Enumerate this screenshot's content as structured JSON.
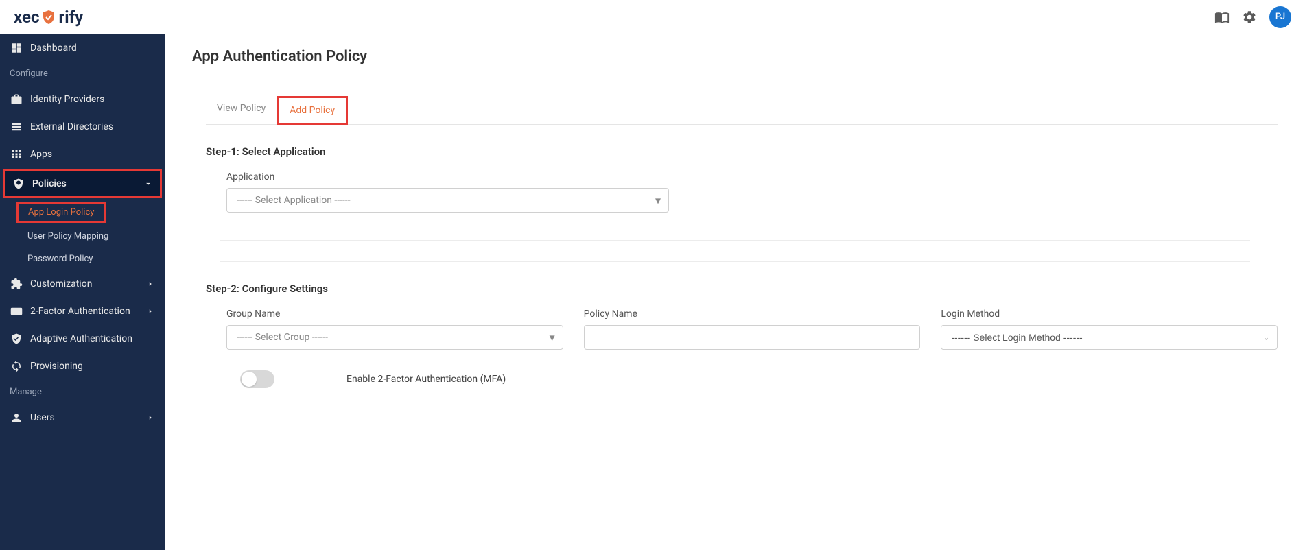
{
  "header": {
    "logo_text_1": "xec",
    "logo_text_2": "rify",
    "avatar": "PJ"
  },
  "sidebar": {
    "items": {
      "dashboard": "Dashboard",
      "configure_section": "Configure",
      "identity_providers": "Identity Providers",
      "external_directories": "External Directories",
      "apps": "Apps",
      "policies": "Policies",
      "app_login_policy": "App Login Policy",
      "user_policy_mapping": "User Policy Mapping",
      "password_policy": "Password Policy",
      "customization": "Customization",
      "two_factor_auth": "2-Factor Authentication",
      "adaptive_auth": "Adaptive Authentication",
      "provisioning": "Provisioning",
      "manage_section": "Manage",
      "users": "Users"
    }
  },
  "page": {
    "title": "App Authentication Policy",
    "tabs": {
      "view": "View Policy",
      "add": "Add Policy"
    },
    "step1": {
      "title": "Step-1: Select Application",
      "application_label": "Application",
      "application_placeholder": "------ Select Application ------"
    },
    "step2": {
      "title": "Step-2: Configure Settings",
      "group_name_label": "Group Name",
      "group_name_placeholder": "------ Select Group ------",
      "policy_name_label": "Policy Name",
      "login_method_label": "Login Method",
      "login_method_placeholder": "------ Select Login Method ------",
      "mfa_toggle_label": "Enable 2-Factor Authentication (MFA)"
    }
  }
}
